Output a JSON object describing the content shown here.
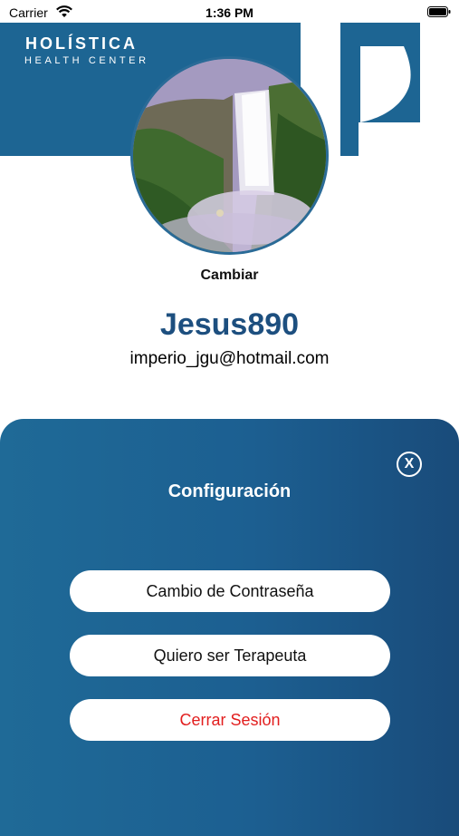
{
  "status_bar": {
    "carrier": "Carrier",
    "time": "1:36 PM"
  },
  "brand": {
    "name": "HOLÍSTICA",
    "subtitle": "HEALTH CENTER",
    "color": "#1d6593"
  },
  "profile": {
    "change_photo_label": "Cambiar",
    "username": "Jesus890",
    "email": "imperio_jgu@hotmail.com"
  },
  "settings": {
    "title": "Configuración",
    "close_label": "X",
    "options": [
      {
        "label": "Cambio de Contraseña"
      },
      {
        "label": "Quiero ser Terapeuta"
      },
      {
        "label": "Cerrar Sesión",
        "color": "#e21e1e"
      }
    ]
  },
  "icons": [
    "wifi-icon",
    "battery-icon",
    "close-icon"
  ]
}
